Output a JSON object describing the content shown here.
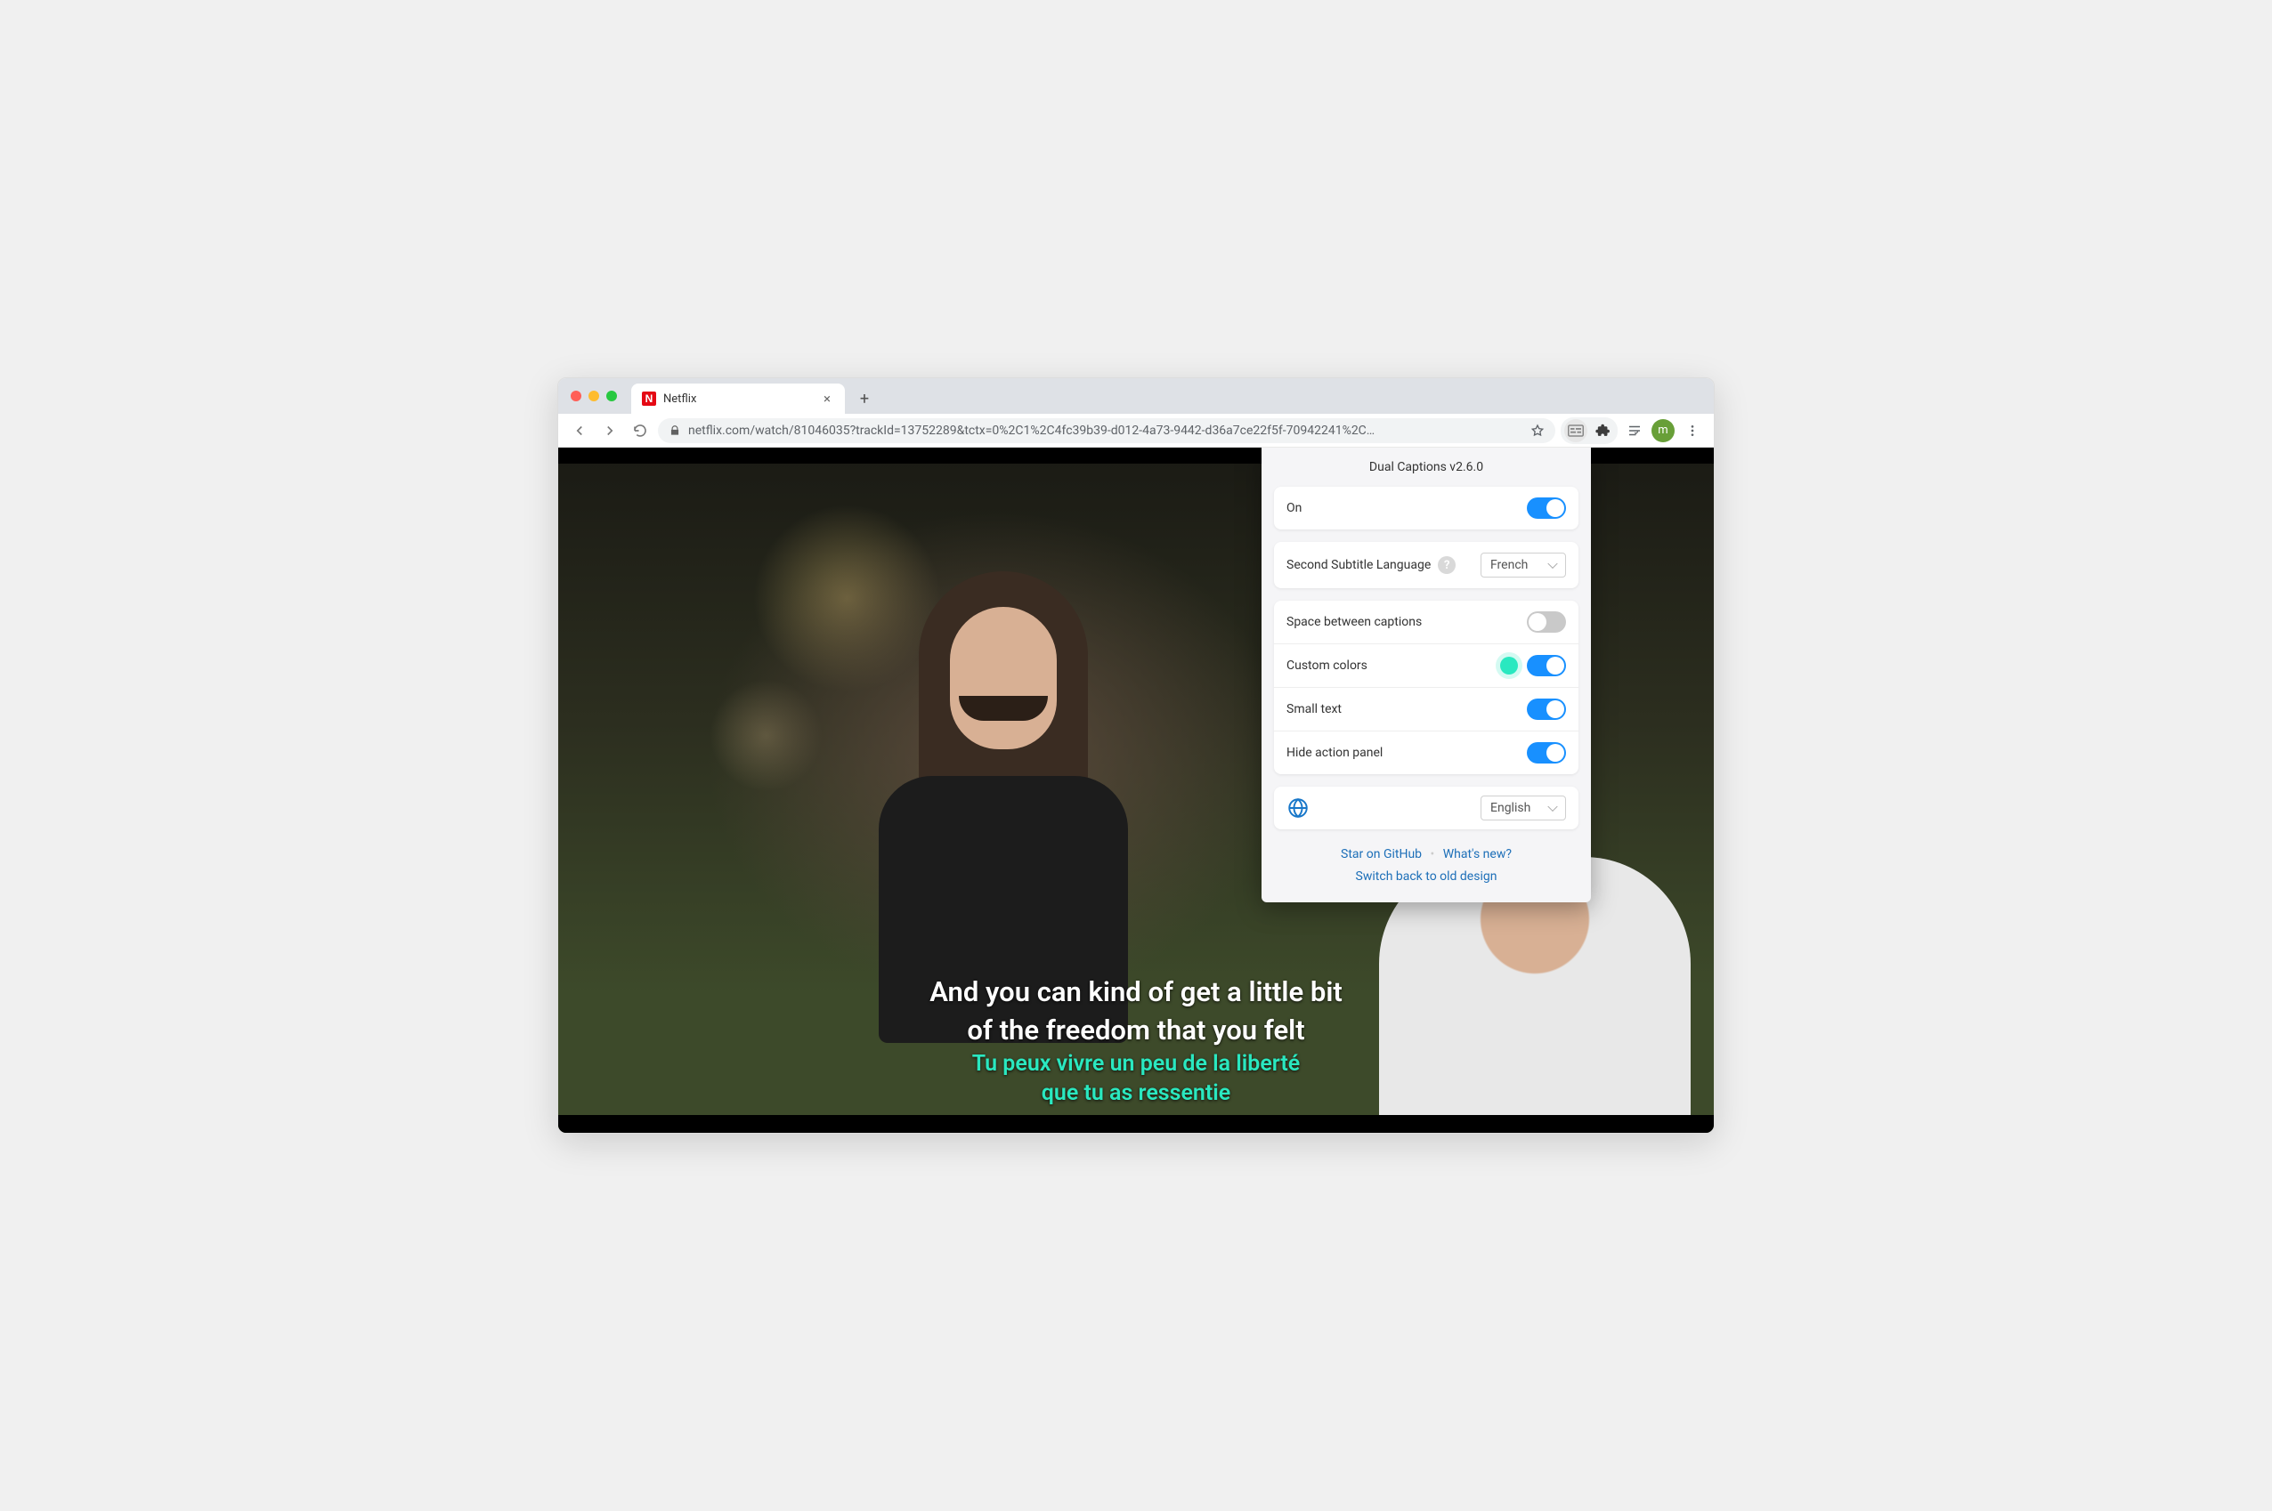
{
  "browser": {
    "tab": {
      "favicon_letter": "N",
      "title": "Netflix"
    },
    "url_display": "netflix.com/watch/81046035?trackId=13752289&tctx=0%2C1%2C4fc39b39-d012-4a73-9442-d36a7ce22f5f-70942241%2C…",
    "avatar_letter": "m"
  },
  "captions": {
    "primary_line1": "And you can kind of get a little bit",
    "primary_line2": "of the freedom that you felt",
    "secondary_line1": "Tu peux vivre un peu de la liberté",
    "secondary_line2": "que tu as ressentie",
    "secondary_color": "#2ae8c0"
  },
  "popup": {
    "title": "Dual Captions v2.6.0",
    "on_label": "On",
    "second_lang_label": "Second Subtitle Language",
    "second_lang_value": "French",
    "space_label": "Space between captions",
    "colors_label": "Custom colors",
    "small_label": "Small text",
    "hide_label": "Hide action panel",
    "ui_lang_value": "English",
    "links": {
      "star": "Star on GitHub",
      "whatsnew": "What's new?",
      "switchback": "Switch back to old design"
    },
    "toggles": {
      "on": true,
      "space": false,
      "colors": true,
      "small": true,
      "hide": true
    }
  }
}
